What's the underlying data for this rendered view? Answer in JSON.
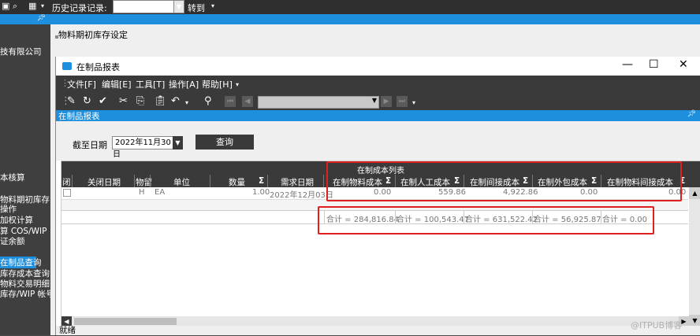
{
  "topbar": {
    "history_label": "历史记录记录:",
    "history_value": "",
    "goto_label": "转到"
  },
  "sidebar": {
    "items": [
      {
        "label": "技有限公司"
      },
      {
        "label": "本核算"
      },
      {
        "label": "物料期初库存"
      },
      {
        "label": "操作"
      },
      {
        "label": "加权计算"
      },
      {
        "label": "算 COS/WIP"
      },
      {
        "label": "证余额"
      },
      {
        "label": "在制品查询"
      },
      {
        "label": "库存成本查询"
      },
      {
        "label": "物料交易明细"
      },
      {
        "label": "库存/WIP 帐号"
      }
    ],
    "selected_index": 7
  },
  "main": {
    "page_title": "物料期初库存设定"
  },
  "window": {
    "title": "在制品报表",
    "controls": {
      "minimize": "—",
      "maximize": "☐",
      "close": "✕"
    },
    "menus": [
      "文件[F]",
      "编辑[E]",
      "工具[T]",
      "操作[A]",
      "帮助[H]"
    ],
    "panel_title": "在制品报表",
    "filter": {
      "date_label": "截至日期",
      "date_value": "2022年11月30日",
      "query_button": "查询"
    },
    "grid": {
      "group_header": "在制成本列表",
      "columns": [
        "闭",
        "关闭日期",
        "物留",
        "单位",
        "数量",
        "需求日期",
        "在制物料成本",
        "在制人工成本",
        "在制间接成本",
        "在制外包成本",
        "在制物料间接成本"
      ],
      "row": {
        "flag": "H",
        "unit": "EA",
        "qty": "1.00",
        "req_date": "2022年12月03日",
        "material_cost": "0.00",
        "labor_cost": "559.86",
        "overhead_cost": "4,922.86",
        "outsource_cost": "0.00",
        "material_overhead_cost": "0.00"
      },
      "sums": [
        "合计 = 284,816.84",
        "合计 = 100,543.47",
        "合计 = 631,522.42",
        "合计 = 56,925.87",
        "合计 = 0.00"
      ]
    },
    "status": "就绪"
  },
  "watermark": "@ITPUB博客",
  "colors": {
    "accent": "#1e8fdc",
    "dark": "#3a3a3a",
    "highlight_box": "#e02020"
  }
}
